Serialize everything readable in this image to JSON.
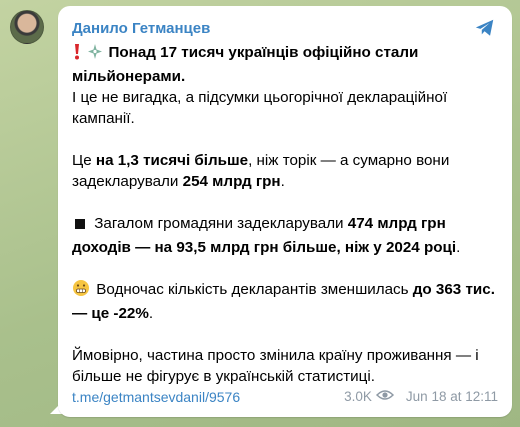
{
  "channel": {
    "author": "Данило Гетманцев",
    "avatar_icon": "author-avatar",
    "share_icon": "share-icon"
  },
  "post": {
    "p1_line1": "Понад 17 тисяч українців офіційно стали мільйонерами.",
    "p1_line2": "І це не вигадка, а підсумки цьогорічної деклараційної кампанії.",
    "p2_a": "Це ",
    "p2_b": "на 1,3 тисячі більше",
    "p2_c": ", ніж торік — а сумарно вони задекларували ",
    "p2_d": "254 млрд грн",
    "p2_e": ".",
    "p3_a": "Загалом громадяни задекларували ",
    "p3_b": "474 млрд грн доходів — на 93,5 млрд грн більше, ніж у 2024 році",
    "p3_c": ".",
    "p4_a": "Водночас кількість декларантів зменшилась ",
    "p4_b": "до 363 тис. — це -22%",
    "p4_c": ".",
    "p5": "Ймовірно, частина просто змінила країну проживання — і більше не фігурує в українській статистиці."
  },
  "footer": {
    "link": "t.me/getmantsevdanil/9576",
    "views": "3.0K",
    "time": "Jun 18 at 12:11"
  },
  "colors": {
    "accent": "#3b84c4",
    "meta": "#8f9aa5"
  }
}
